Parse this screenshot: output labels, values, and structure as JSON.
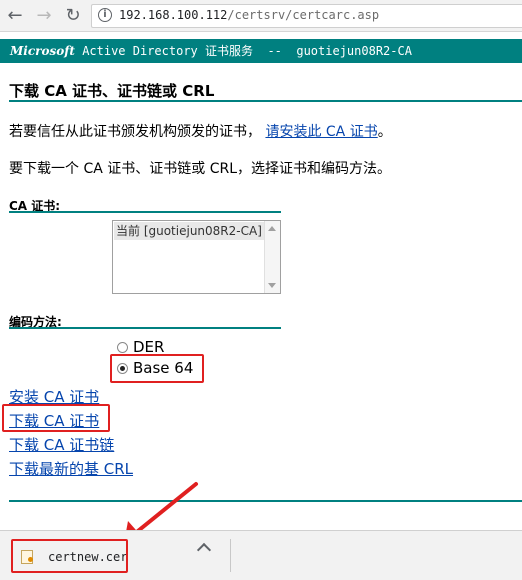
{
  "browser": {
    "url_host": "192.168.100.112",
    "url_path": "/certsrv/certcarc.asp"
  },
  "banner": {
    "brand": "Microsoft",
    "title": "Active Directory 证书服务  --  guotiejun08R2-CA"
  },
  "page": {
    "heading": "下载 CA 证书、证书链或 CRL",
    "trust_text": "若要信任从此证书颁发机构颁发的证书，",
    "trust_link": "请安装此 CA 证书",
    "trust_end": "。",
    "instructions": "要下载一个 CA 证书、证书链或 CRL，选择证书和编码方法。",
    "ca_cert_label": "CA 证书:",
    "ca_cert_options": [
      "当前 [guotiejun08R2-CA]"
    ],
    "encoding_label": "编码方法:",
    "encoding_options": [
      "DER",
      "Base 64"
    ],
    "encoding_selected": "Base 64",
    "links": [
      "安装 CA 证书",
      "下载 CA 证书",
      "下载 CA 证书链",
      "下载最新的基 CRL"
    ]
  },
  "downloads": {
    "file_name": "certnew.cer"
  },
  "colors": {
    "accent": "#008080",
    "highlight": "#e02020",
    "link": "#0645ad"
  }
}
